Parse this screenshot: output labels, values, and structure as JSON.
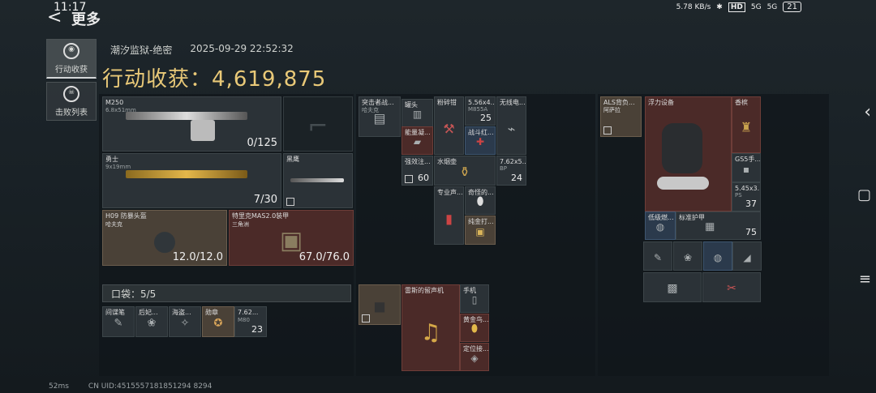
{
  "status": {
    "time": "11:17",
    "speed": "5.78 KB/s",
    "hd": "HD",
    "net1": "5G",
    "net2": "5G",
    "battery": "21"
  },
  "nav": {
    "back_label": "<",
    "title": "更多"
  },
  "tabs": [
    {
      "label": "行动收获",
      "icon": "gear-icon"
    },
    {
      "label": "击败列表",
      "icon": "skull-icon"
    }
  ],
  "raid": {
    "map": "潮汐监狱-绝密",
    "datetime": "2025-09-29 22:52:32",
    "haul_label": "行动收获：",
    "haul_value": "4,619,875"
  },
  "weapons": {
    "primary": {
      "name": "M250",
      "ammo": "6.8x51mm",
      "count": "0/125"
    },
    "pistol": {
      "name": ""
    },
    "secondary": {
      "name": "勇士",
      "ammo": "9x19mm",
      "count": "7/30"
    },
    "melee": {
      "name": "黑鹰"
    },
    "helmet": {
      "name": "H09 防暴头盔",
      "sub": "哈夫克",
      "dur": "12.0/12.0"
    },
    "armor": {
      "name": "特里克MAS2.0装甲",
      "sub": "三角洲",
      "dur": "67.0/76.0"
    }
  },
  "pockets": {
    "label": "口袋：5/5",
    "items": [
      {
        "name": "间谍笔"
      },
      {
        "name": "后妃..."
      },
      {
        "name": "海盗..."
      },
      {
        "name": "勋章"
      },
      {
        "name": "7.62...",
        "sub": "M80",
        "count": "23"
      }
    ]
  },
  "chest": {
    "items": [
      {
        "name": "突击者战...",
        "sub": "哈夫克"
      },
      {
        "name": "罐头"
      },
      {
        "name": "粉碎钳"
      },
      {
        "name": "5.56x4...",
        "sub": "M855A",
        "count": "25"
      },
      {
        "name": "无线电..."
      },
      {
        "name": "能量凝..."
      },
      {
        "name": "战斗红..."
      },
      {
        "name": "强效注...",
        "count": "60"
      },
      {
        "name": "水烟壶"
      },
      {
        "name": "7.62x5...",
        "sub": "BP",
        "count": "24"
      },
      {
        "name": "专业声..."
      },
      {
        "name": "奇怪的..."
      },
      {
        "name": "纯金打..."
      }
    ]
  },
  "chest_lower": {
    "items": [
      {
        "name": ""
      },
      {
        "name": "雷斯的留声机"
      },
      {
        "name": "手机"
      },
      {
        "name": "黄金鸟..."
      },
      {
        "name": "定位接..."
      }
    ]
  },
  "backpack": {
    "items": [
      {
        "name": "ALS背负...",
        "sub": "阿萨拉"
      },
      {
        "name": "浮力设备"
      },
      {
        "name": "香槟"
      },
      {
        "name": "GS5手..."
      },
      {
        "name": "5.45x3...",
        "sub": "PS",
        "count": "37"
      },
      {
        "name": "低级燃..."
      },
      {
        "name": "标准护甲",
        "count": "75"
      }
    ]
  },
  "footer": {
    "ping": "52ms",
    "uid": "CN UID:4515557181851294 8294"
  }
}
